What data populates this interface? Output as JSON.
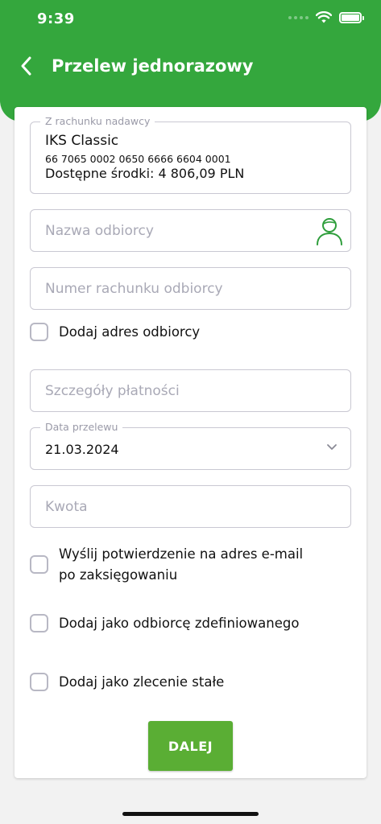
{
  "status_bar": {
    "time": "9:39",
    "icons": [
      "signal-dots-icon",
      "wifi-icon",
      "battery-icon"
    ]
  },
  "header": {
    "title": "Przelew jednorazowy",
    "back_icon": "chevron-left-icon"
  },
  "sender_account": {
    "legend": "Z rachunku nadawcy",
    "name": "IKS Classic",
    "number": "66 7065 0002 0650 6666 6604 0001",
    "balance": "Dostępne środki: 4 806,09 PLN"
  },
  "recipient_name": {
    "placeholder": "Nazwa odbiorcy",
    "icon": "person-icon"
  },
  "recipient_account": {
    "placeholder": "Numer rachunku odbiorcy"
  },
  "add_address": {
    "label": "Dodaj adres odbiorcy",
    "checked": false
  },
  "payment_details": {
    "placeholder": "Szczegóły płatności"
  },
  "transfer_date": {
    "legend": "Data przelewu",
    "value": "21.03.2024",
    "icon": "chevron-down-icon"
  },
  "amount": {
    "placeholder": "Kwota"
  },
  "send_confirmation": {
    "label_line1": "Wyślij potwierdzenie na adres e-mail",
    "label_line2": "po zaksięgowaniu",
    "checked": false
  },
  "add_defined_recipient": {
    "label": "Dodaj jako odbiorcę zdefiniowanego",
    "checked": false
  },
  "add_standing_order": {
    "label": "Dodaj jako zlecenie stałe",
    "checked": false
  },
  "next_button": {
    "label": "DALEJ"
  },
  "colors": {
    "brand_green": "#34a73d",
    "button_green": "#5aae34",
    "icon_green": "#2f9e3c",
    "border_gray": "#c9c8d2",
    "placeholder_gray": "#a9a9b6"
  }
}
